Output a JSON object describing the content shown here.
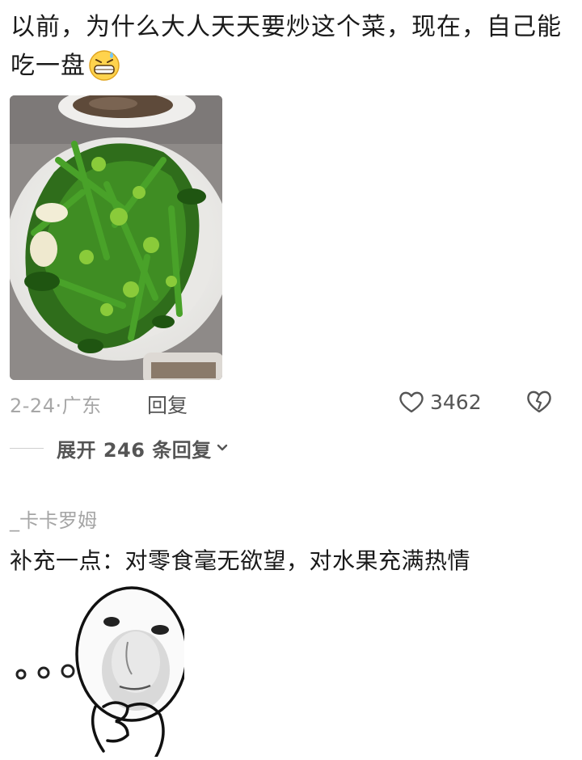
{
  "comment1": {
    "text": "以前，为什么大人天天要炒这个菜，现在，自己能吃一盘",
    "emoji_icon": "grinning-sweat-emoji",
    "photo_icon": "stir-fried-greens-photo",
    "date_location": "2-24·广东",
    "reply_label": "回复",
    "like_count": "3462"
  },
  "replies": {
    "expand_label": "展开 246 条回复"
  },
  "comment2": {
    "username": "_卡卡罗姆",
    "text": "补充一点：对零食毫无欲望，对水果充满热情",
    "sticker_icon": "thinking-meme-sticker"
  }
}
